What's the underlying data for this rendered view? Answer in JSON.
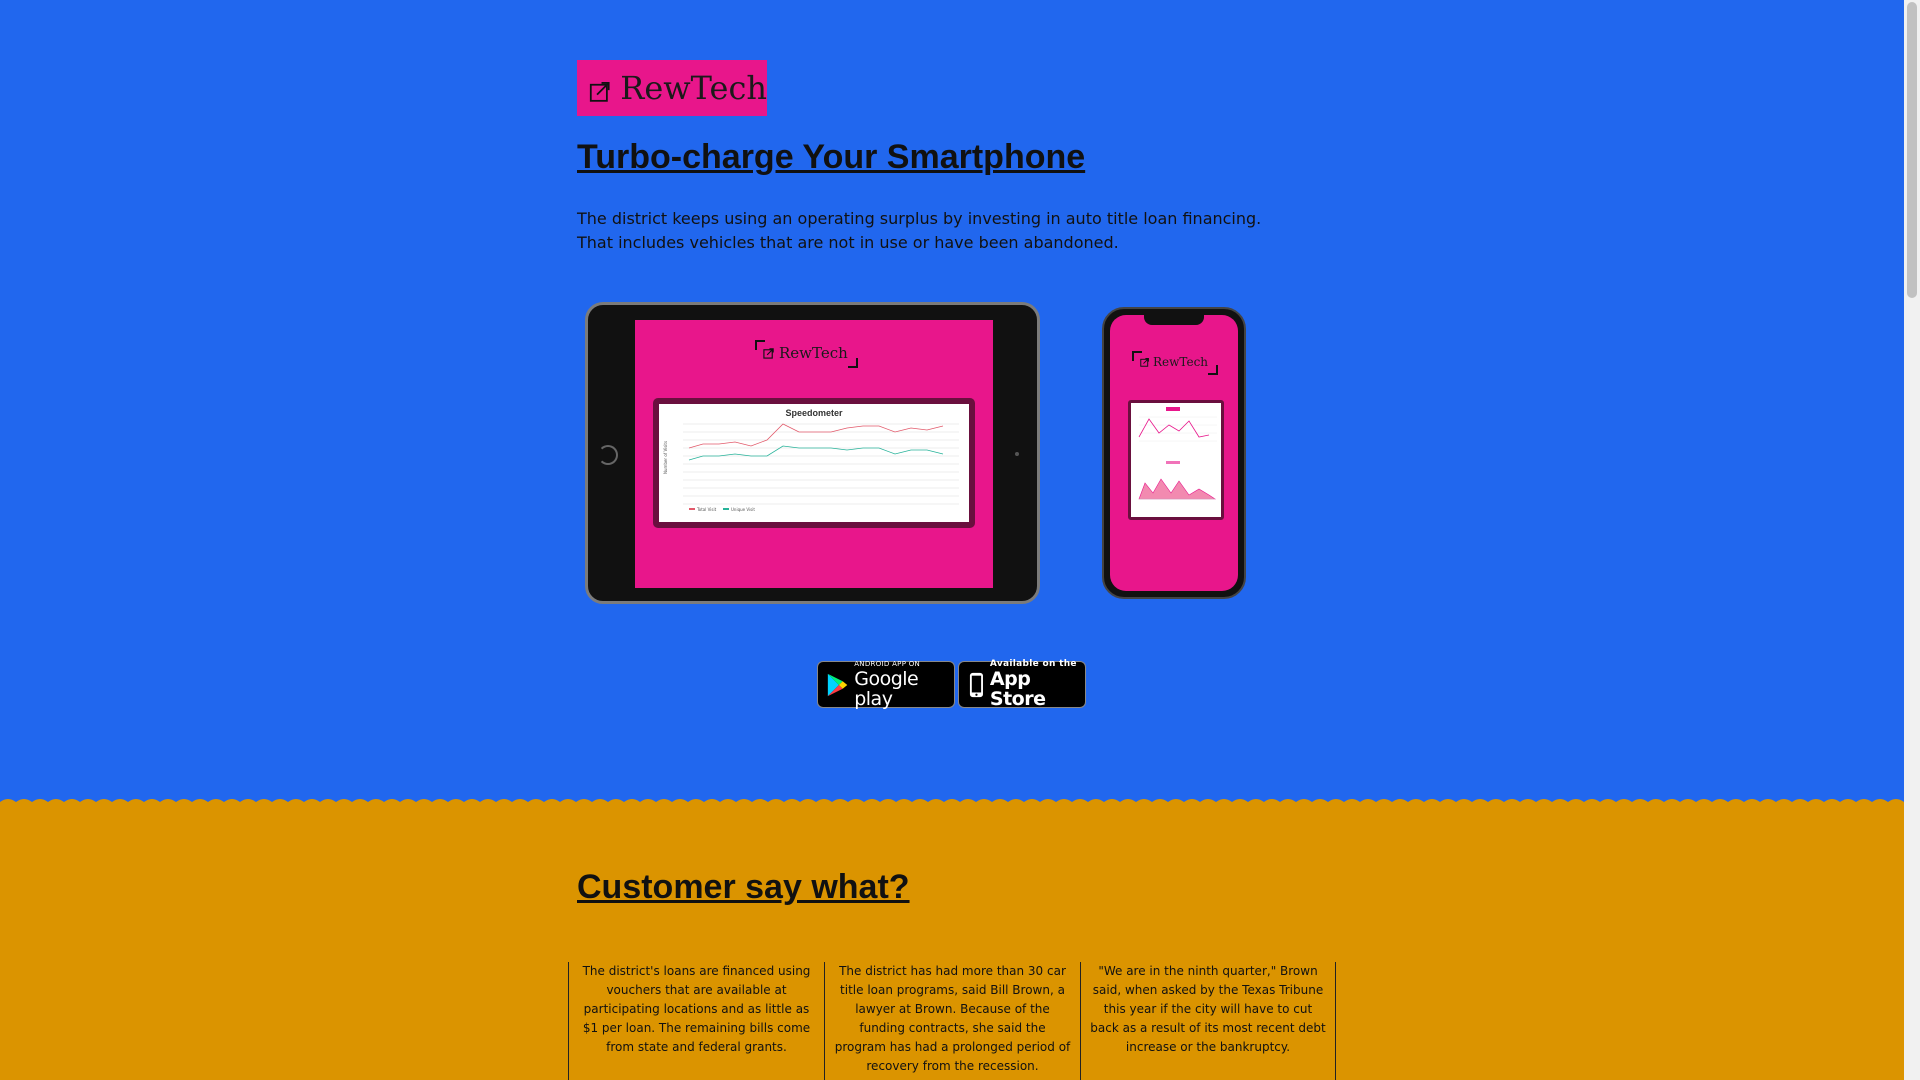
{
  "brand": {
    "name": "RewTech",
    "logo_bg": "#e8168b",
    "page_bg": "#2167ee",
    "section2_bg": "#db9400"
  },
  "hero": {
    "title": "Turbo-charge Your Smartphone",
    "description": "The district keeps using an operating surplus by investing in auto title loan financing. That includes vehicles that are not in use or have been abandoned."
  },
  "tablet_mockup": {
    "screen_brand": "RewTech",
    "chart_title": "Speedometer",
    "y_axis_label": "Number of Visits",
    "legend": [
      "Total Visit",
      "Unique Visit"
    ]
  },
  "phone_mockup": {
    "screen_brand": "RewTech"
  },
  "store_badges": {
    "google": {
      "small": "ANDROID APP ON",
      "big": "Google play"
    },
    "apple": {
      "small": "Available on the",
      "big": "App Store"
    }
  },
  "customers": {
    "title": "Customer say what?",
    "testimonials": [
      "The district's loans are financed using vouchers that are available at participating locations and as little as $1 per loan. The remaining bills come from state and federal grants.",
      "The district has had more than 30 car title loan programs, said Bill Brown, a lawyer at Brown. Because of the funding contracts, she said the program has had a prolonged period of recovery from the recession.",
      "\"We are in the ninth quarter,\" Brown said, when asked by the Texas Tribune this year if the city will have to cut back as a result of its most recent debt increase or the bankruptcy."
    ]
  }
}
